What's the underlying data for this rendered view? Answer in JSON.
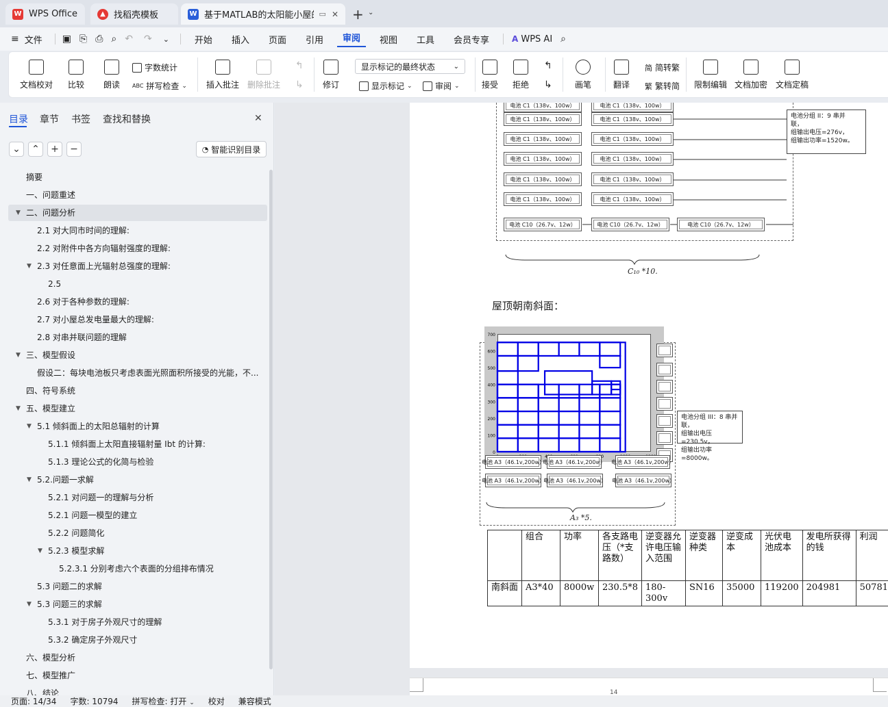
{
  "tabs": [
    {
      "label": "WPS Office"
    },
    {
      "label": "找稻壳模板"
    },
    {
      "label": "基于MATLAB的太阳能小屋的"
    }
  ],
  "menu": {
    "file": "文件",
    "items": [
      "开始",
      "插入",
      "页面",
      "引用",
      "审阅",
      "视图",
      "工具",
      "会员专享"
    ],
    "wps_ai": "WPS AI"
  },
  "ribbon": {
    "doc_check": "文档校对",
    "compare": "比较",
    "read_aloud": "朗读",
    "word_count": "字数统计",
    "spell_check": "拼写检查",
    "insert_comment": "插入批注",
    "delete_comment": "删除批注",
    "track": "修订",
    "display_state": "显示标记的最终状态",
    "show_markup": "显示标记",
    "review": "审阅",
    "accept": "接受",
    "reject": "拒绝",
    "pen": "画笔",
    "translate": "翻译",
    "to_trad": "简转繁",
    "to_simp": "繁转简",
    "restrict": "限制编辑",
    "encrypt": "文档加密",
    "finalize": "文档定稿"
  },
  "sidebar": {
    "tabs": [
      "目录",
      "章节",
      "书签",
      "查找和替换"
    ],
    "smart_btn": "智能识别目录",
    "toc": [
      {
        "text": "摘要",
        "level": 1,
        "arrow": ""
      },
      {
        "text": "一、问题重述",
        "level": 1,
        "arrow": ""
      },
      {
        "text": "二、问题分析",
        "level": 1,
        "arrow": "▼"
      },
      {
        "text": "2.1 对大同市时间的理解:",
        "level": 2,
        "arrow": ""
      },
      {
        "text": "2.2 对附件中各方向辐射强度的理解:",
        "level": 2,
        "arrow": ""
      },
      {
        "text": "2.3 对任意面上光辐射总强度的理解:",
        "level": 2,
        "arrow": "▼"
      },
      {
        "text": "2.5",
        "level": 3,
        "arrow": ""
      },
      {
        "text": "2.6 对于各种参数的理解:",
        "level": 2,
        "arrow": ""
      },
      {
        "text": "2.7 对小屋总发电量最大的理解:",
        "level": 2,
        "arrow": ""
      },
      {
        "text": "2.8 对串并联问题的理解",
        "level": 2,
        "arrow": ""
      },
      {
        "text": "三、模型假设",
        "level": 1,
        "arrow": "▼"
      },
      {
        "text": "假设二：每块电池板只考虑表面光照面积所接受的光能，不...",
        "level": 2,
        "arrow": ""
      },
      {
        "text": "四、符号系统",
        "level": 1,
        "arrow": ""
      },
      {
        "text": "五、模型建立",
        "level": 1,
        "arrow": "▼"
      },
      {
        "text": "5.1 倾斜面上的太阳总辐射的计算",
        "level": 2,
        "arrow": "▼"
      },
      {
        "text": "5.1.1 倾斜面上太阳直接辐射量 Ibt 的计算:",
        "level": 3,
        "arrow": ""
      },
      {
        "text": "5.1.3 理论公式的化简与检验",
        "level": 3,
        "arrow": ""
      },
      {
        "text": "5.2.问题一求解",
        "level": 2,
        "arrow": "▼"
      },
      {
        "text": "5.2.1 对问题一的理解与分析",
        "level": 3,
        "arrow": ""
      },
      {
        "text": "5.2.1 问题一模型的建立",
        "level": 3,
        "arrow": ""
      },
      {
        "text": "5.2.2 问题简化",
        "level": 3,
        "arrow": ""
      },
      {
        "text": "5.2.3 模型求解",
        "level": 3,
        "arrow": "▼"
      },
      {
        "text": "5.2.3.1 分别考虑六个表面的分组排布情况",
        "level": 4,
        "arrow": ""
      },
      {
        "text": "5.3 问题二的求解",
        "level": 2,
        "arrow": ""
      },
      {
        "text": "5.3 问题三的求解",
        "level": 2,
        "arrow": "▼"
      },
      {
        "text": "5.3.1 对于房子外观尺寸的理解",
        "level": 3,
        "arrow": ""
      },
      {
        "text": "5.3.2 确定房子外观尺寸",
        "level": 3,
        "arrow": ""
      },
      {
        "text": "六、模型分析",
        "level": 1,
        "arrow": ""
      },
      {
        "text": "七、模型推广",
        "level": 1,
        "arrow": ""
      },
      {
        "text": "八、结论",
        "level": 1,
        "arrow": ""
      }
    ]
  },
  "document": {
    "battery_c1": "电池 C1（138v、100w）",
    "battery_c10": "电池 C10（26.7v、12w）",
    "battery_a3": "电池 A3（46.1v,200w）",
    "group2_note": [
      "电池分组 II：9 串并",
      "联，",
      "组输出电压=276v，",
      "组输出功率=1520w。"
    ],
    "c10_label": "C₁₀ *10.",
    "section_title": "屋顶朝南斜面：",
    "group3_note": [
      "电池分组 III：8 串并联，",
      "组输出电压=230.5v，",
      "组输出功率=8000w。"
    ],
    "a3_label": "A₃ *5.",
    "table": {
      "headers": [
        "",
        "组合",
        "功率",
        "各支路电压（*支路数）",
        "逆变器允许电压输入范围",
        "逆变器种类",
        "逆变成本",
        "光伏电池成本",
        "发电所获得的钱",
        "利润"
      ],
      "row": [
        "南斜面",
        "A3*40",
        "8000w",
        "230.5*8",
        "180-300v",
        "SN16",
        "35000",
        "119200",
        "204981",
        "50781"
      ]
    },
    "page_number": "14"
  },
  "plot": {
    "y_ticks": [
      "700",
      "600",
      "500",
      "400",
      "300",
      "200",
      "100",
      "0"
    ],
    "x_ticks": [
      "0",
      "200",
      "400",
      "600",
      "800",
      "1000",
      "1200"
    ]
  },
  "status": {
    "page": "页面: 14/34",
    "words": "字数: 10794",
    "spell": "拼写检查: 打开",
    "proof": "校对",
    "compat": "兼容模式"
  }
}
